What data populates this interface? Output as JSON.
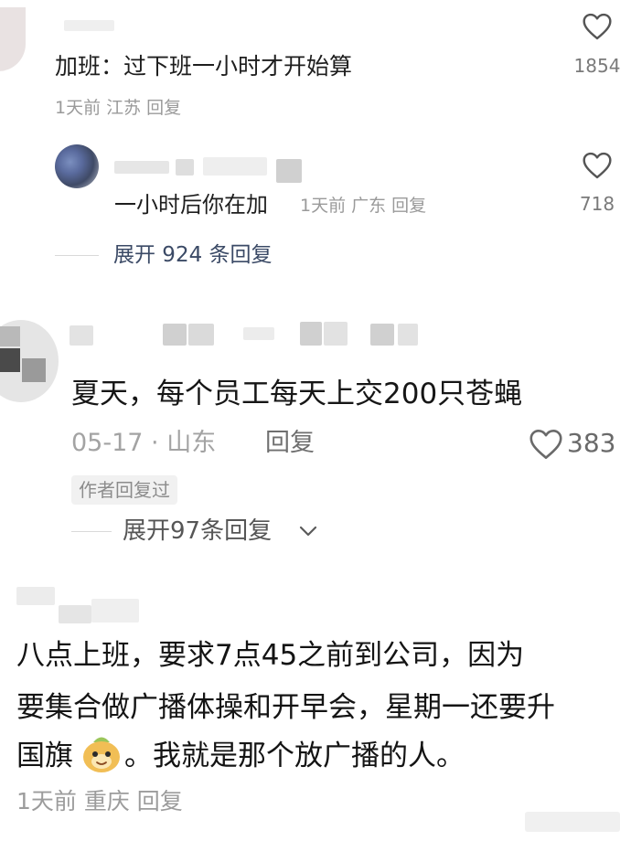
{
  "comment1": {
    "text": "加班：过下班一小时才开始算",
    "meta": "1天前 江苏 回复",
    "likes": "1854"
  },
  "reply1": {
    "text": "一小时后你在加",
    "meta": "1天前 广东 回复",
    "likes": "718"
  },
  "expand1": "展开 924 条回复",
  "comment2": {
    "text": "夏天，每个员工每天上交200只苍蝇",
    "date_location": "05-17 · 山东",
    "reply_label": "回复",
    "likes": "383",
    "author_badge": "作者回复过"
  },
  "expand2": "展开97条回复",
  "comment3": {
    "line1": "八点上班，要求7点45之前到公司，因为",
    "line2": "要集合做广播体操和开早会，星期一还要升",
    "line3_prefix": "国旗",
    "line3_suffix": "。我就是那个放广播的人。",
    "meta": "1天前 重庆 回复"
  },
  "icons": {
    "like": "heart-outline-icon",
    "expand": "chevron-down-icon",
    "emoji": "cat-face-emoji-icon"
  }
}
